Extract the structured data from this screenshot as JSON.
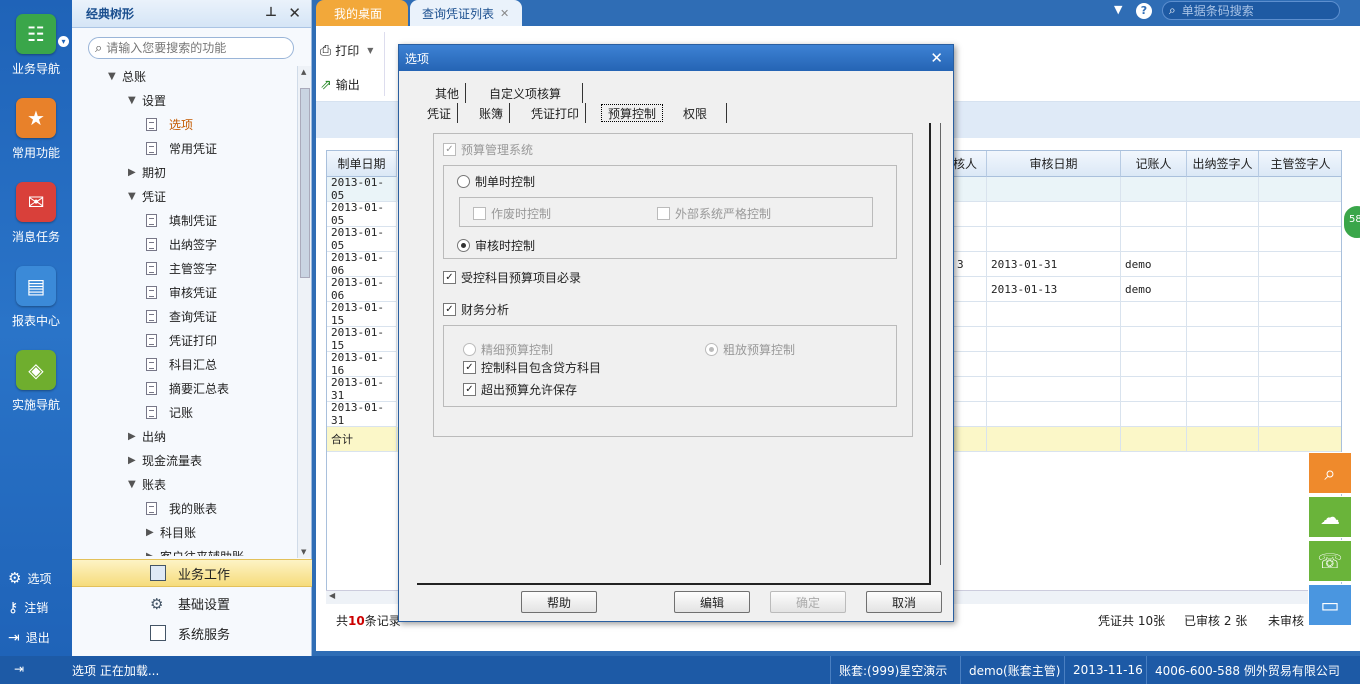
{
  "rail": {
    "items": [
      {
        "label": "业务导航",
        "icon": "business-nav-icon",
        "color": "#3aa64a"
      },
      {
        "label": "常用功能",
        "icon": "star-icon",
        "color": "#e8812a"
      },
      {
        "label": "消息任务",
        "icon": "mail-icon",
        "color": "#d9403a"
      },
      {
        "label": "报表中心",
        "icon": "report-icon",
        "color": "#3b8ad8"
      },
      {
        "label": "实施导航",
        "icon": "compass-icon",
        "color": "#6fae2e"
      }
    ],
    "bottom": [
      {
        "label": "选项",
        "icon": "gear-icon"
      },
      {
        "label": "注销",
        "icon": "key-icon"
      },
      {
        "label": "退出",
        "icon": "exit-icon"
      }
    ]
  },
  "tree": {
    "title": "经典树形",
    "search_placeholder": "请输入您要搜索的功能",
    "nodes": [
      {
        "label": "总账",
        "level": 1,
        "type": "open"
      },
      {
        "label": "设置",
        "level": 2,
        "type": "open"
      },
      {
        "label": "选项",
        "level": 3,
        "type": "doc",
        "active": true
      },
      {
        "label": "常用凭证",
        "level": 3,
        "type": "doc"
      },
      {
        "label": "期初",
        "level": 2,
        "type": "closed"
      },
      {
        "label": "凭证",
        "level": 2,
        "type": "open"
      },
      {
        "label": "填制凭证",
        "level": 3,
        "type": "doc"
      },
      {
        "label": "出纳签字",
        "level": 3,
        "type": "doc"
      },
      {
        "label": "主管签字",
        "level": 3,
        "type": "doc"
      },
      {
        "label": "审核凭证",
        "level": 3,
        "type": "doc"
      },
      {
        "label": "查询凭证",
        "level": 3,
        "type": "doc"
      },
      {
        "label": "凭证打印",
        "level": 3,
        "type": "doc"
      },
      {
        "label": "科目汇总",
        "level": 3,
        "type": "doc"
      },
      {
        "label": "摘要汇总表",
        "level": 3,
        "type": "doc"
      },
      {
        "label": "记账",
        "level": 3,
        "type": "doc"
      },
      {
        "label": "出纳",
        "level": 2,
        "type": "closed"
      },
      {
        "label": "现金流量表",
        "level": 2,
        "type": "closed"
      },
      {
        "label": "账表",
        "level": 2,
        "type": "open"
      },
      {
        "label": "我的账表",
        "level": 3,
        "type": "doc"
      },
      {
        "label": "科目账",
        "level": 3,
        "type": "closed"
      },
      {
        "label": "客户往来辅助账",
        "level": 3,
        "type": "closed"
      }
    ],
    "bottom": [
      {
        "label": "业务工作",
        "active": true
      },
      {
        "label": "基础设置"
      },
      {
        "label": "系统服务"
      }
    ]
  },
  "tabs": [
    {
      "label": "我的桌面"
    },
    {
      "label": "查询凭证列表"
    }
  ],
  "top_search_placeholder": "单据条码搜索",
  "toolbar": {
    "print": "打印",
    "export": "输出"
  },
  "grid": {
    "headers": [
      "制单日期",
      "核人",
      "审核日期",
      "记账人",
      "出纳签字人",
      "主管签字人"
    ],
    "rows": [
      [
        "2013-01-05",
        "",
        "",
        "",
        "",
        ""
      ],
      [
        "2013-01-05",
        "",
        "",
        "",
        "",
        ""
      ],
      [
        "2013-01-05",
        "",
        "",
        "",
        "",
        ""
      ],
      [
        "2013-01-06",
        "3",
        "2013-01-31",
        "demo",
        "",
        ""
      ],
      [
        "2013-01-06",
        "",
        "2013-01-13",
        "demo",
        "",
        ""
      ],
      [
        "2013-01-15",
        "",
        "",
        "",
        "",
        ""
      ],
      [
        "2013-01-15",
        "",
        "",
        "",
        "",
        ""
      ],
      [
        "2013-01-16",
        "",
        "",
        "",
        "",
        ""
      ],
      [
        "2013-01-31",
        "",
        "",
        "",
        "",
        ""
      ],
      [
        "2013-01-31",
        "",
        "",
        "",
        "",
        ""
      ],
      [
        "合计",
        "",
        "",
        "",
        "",
        ""
      ]
    ],
    "footer_prefix": "共",
    "footer_count": "10",
    "footer_suffix": "条记录",
    "summary": [
      "凭证共 10张",
      "已审核 2 张",
      "未审核"
    ]
  },
  "dialog": {
    "title": "选项",
    "tabs_row1": [
      "其他",
      "自定义项核算"
    ],
    "tabs_row2": [
      "凭证",
      "账簿",
      "凭证打印",
      "预算控制",
      "权限"
    ],
    "budget_mgmt": "预算管理系统",
    "radio_make": "制单时控制",
    "chk_void": "作废时控制",
    "chk_external": "外部系统严格控制",
    "radio_audit": "审核时控制",
    "chk_required": "受控科目预算项目必录",
    "chk_finance": "财务分析",
    "radio_fine": "精细预算控制",
    "radio_rough": "粗放预算控制",
    "chk_include": "控制科目包含贷方科目",
    "chk_over": "超出预算允许保存",
    "buttons": {
      "help": "帮助",
      "edit": "编辑",
      "ok": "确定",
      "cancel": "取消"
    }
  },
  "status": {
    "loading": "选项 正在加载...",
    "account": "账套:(999)星空演示",
    "user": "demo(账套主管)",
    "date": "2013-11-16",
    "company": "4006-600-588 例外贸易有限公司"
  },
  "badge": "58",
  "colors": {
    "accent": "#2f6db5",
    "active_tab": "#f2a83a",
    "highlight": "#f5e98a"
  }
}
